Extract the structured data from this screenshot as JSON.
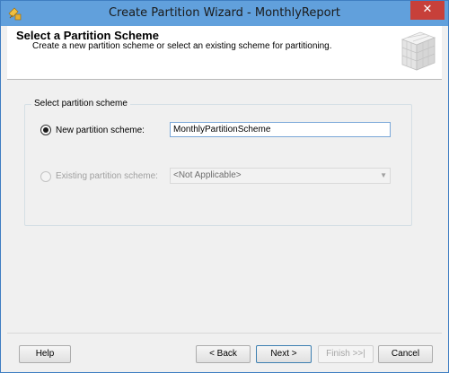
{
  "window": {
    "title": "Create Partition Wizard - MonthlyReport",
    "close_label": "✕"
  },
  "header": {
    "title": "Select a Partition Scheme",
    "subtitle": "Create a new partition scheme or select an existing scheme for partitioning."
  },
  "group": {
    "legend": "Select partition scheme",
    "new_option": {
      "label": "New partition scheme:",
      "checked": true,
      "value": "MonthlyPartitionScheme"
    },
    "existing_option": {
      "label": "Existing partition scheme:",
      "checked": false,
      "enabled": false,
      "selected": "<Not Applicable>"
    }
  },
  "footer": {
    "help_label": "Help",
    "back_label": "< Back",
    "next_label": "Next >",
    "finish_label": "Finish >>|",
    "cancel_label": "Cancel"
  },
  "icons": {
    "app": "wizard-app-icon",
    "header_graphic": "partition-cube-icon",
    "combo_arrow": "chevron-down-icon"
  },
  "colors": {
    "title_bar": "#61a0dc",
    "close_button": "#c7403a",
    "input_border": "#7aa7d8",
    "default_button_border": "#3c7fb1"
  }
}
